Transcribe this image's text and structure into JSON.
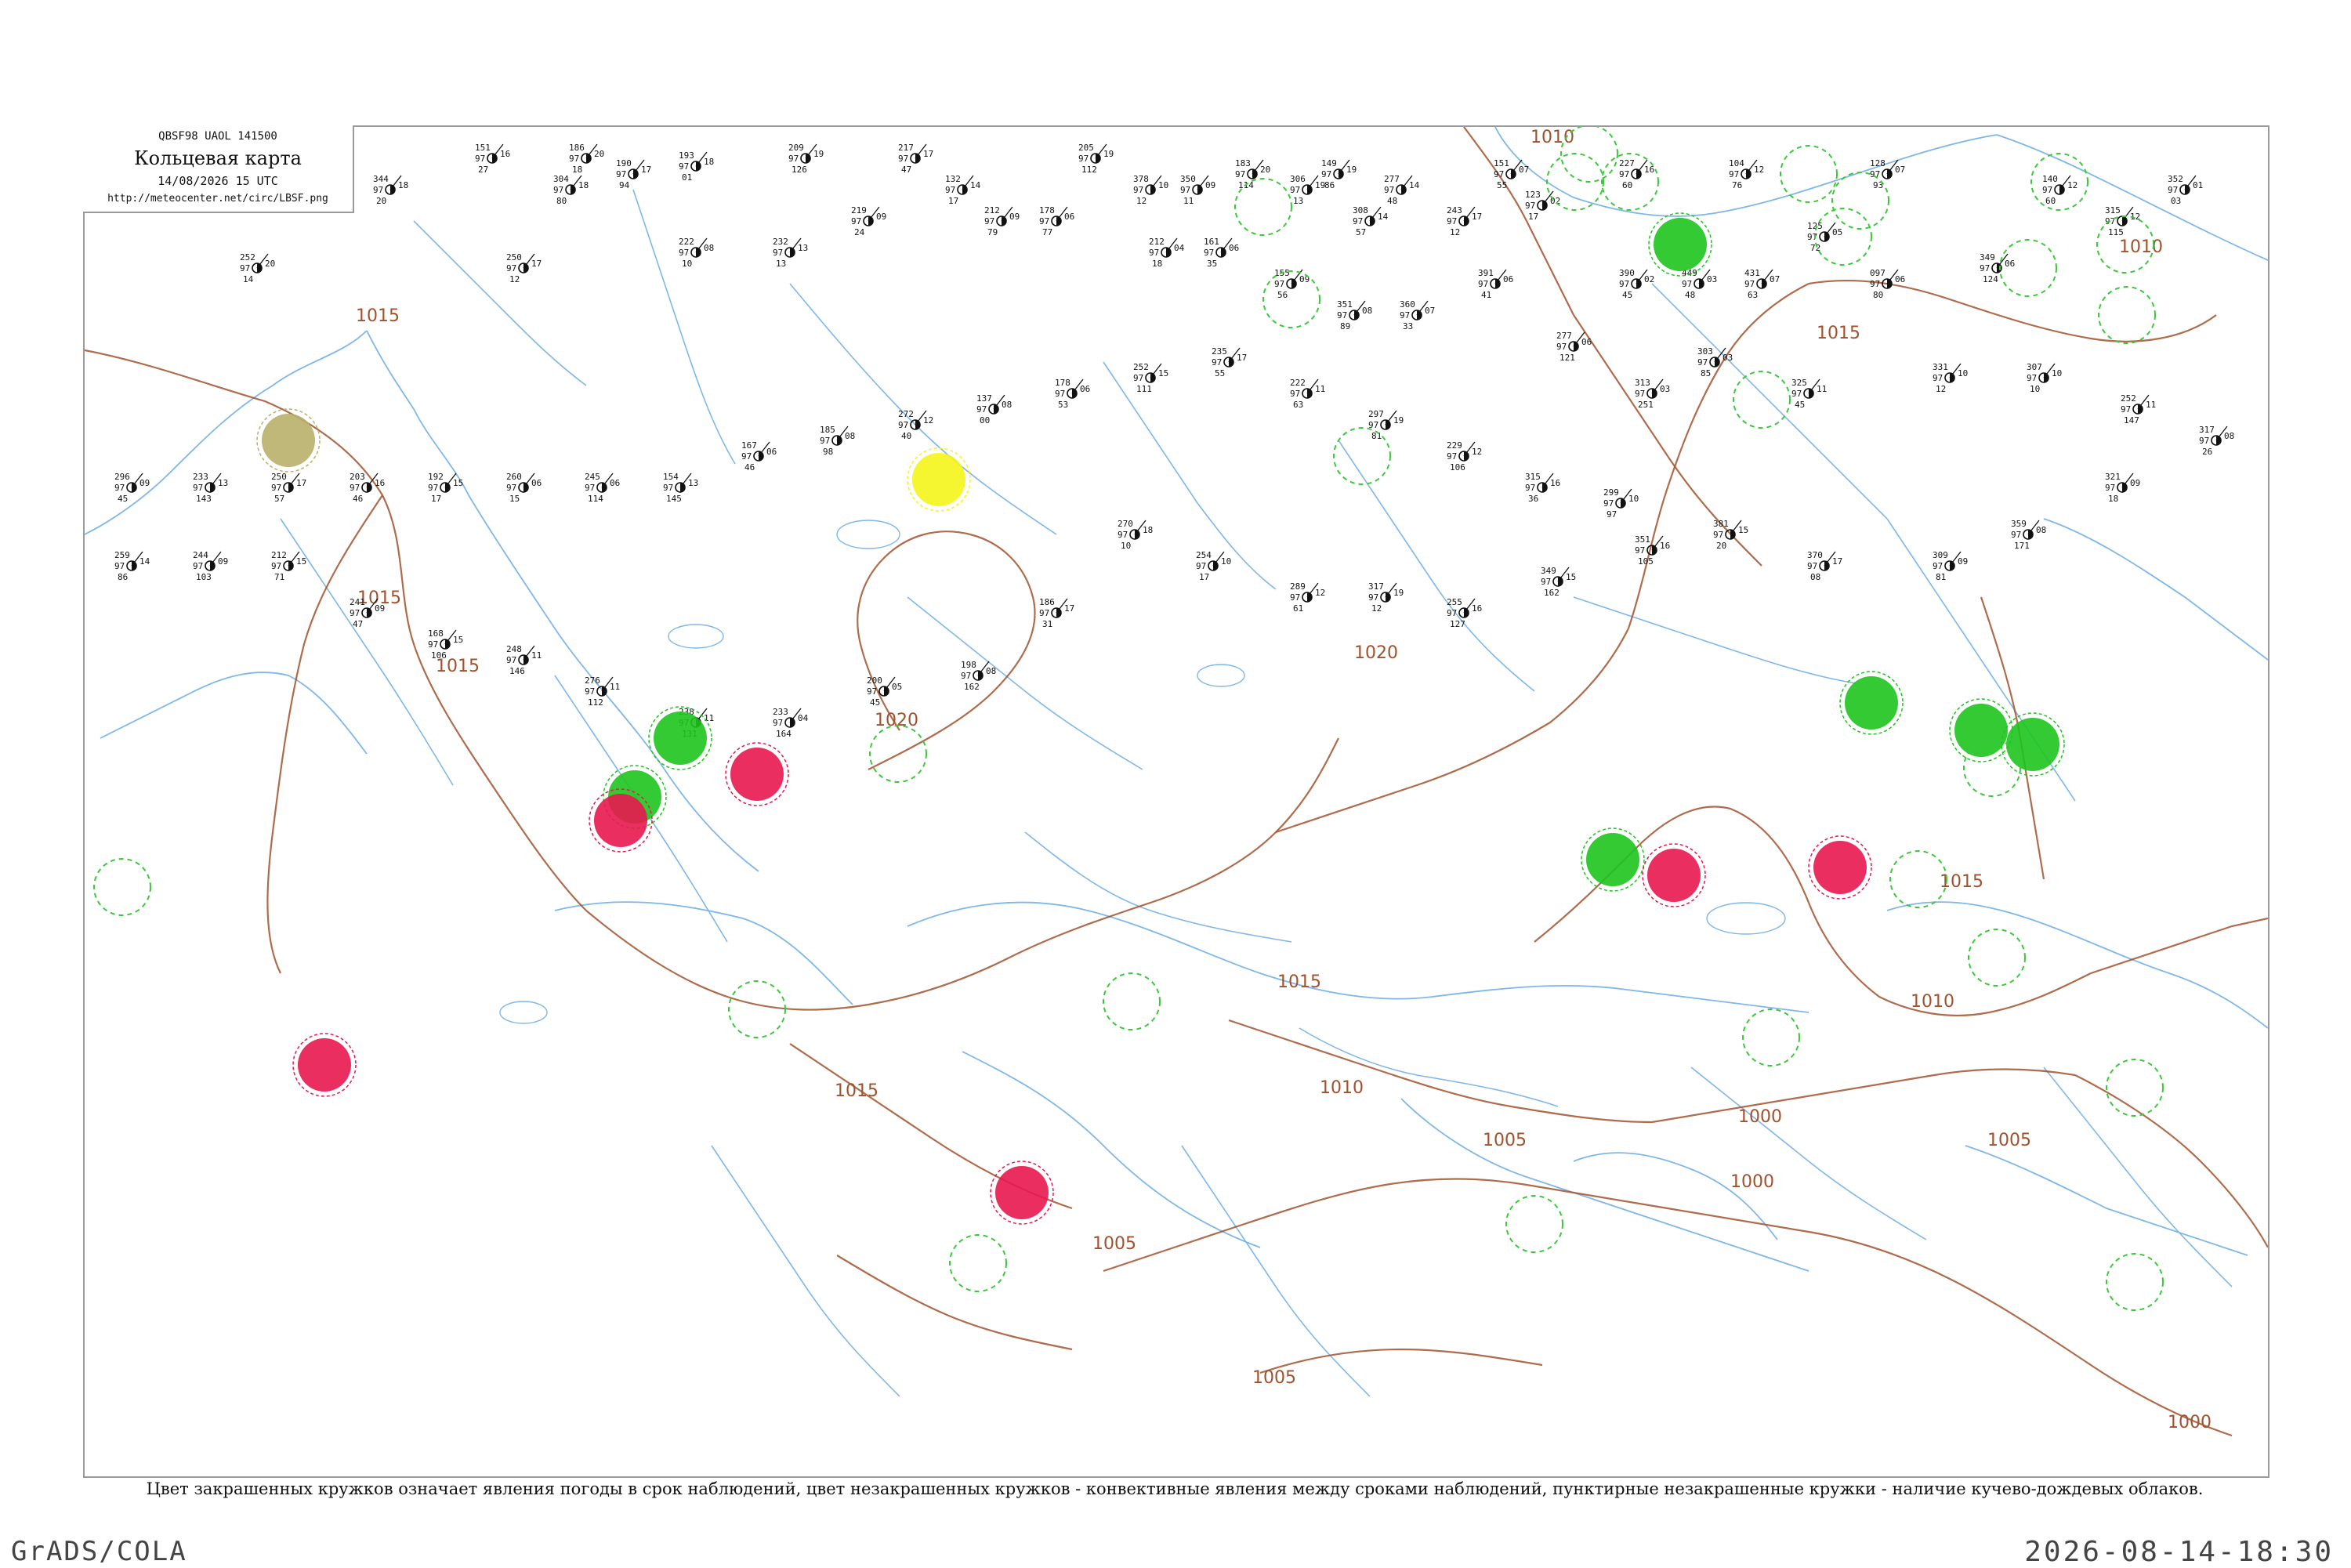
{
  "header": {
    "code_line": "QBSF98  UAOL  141500",
    "title": "Кольцевая карта",
    "datetime": "14/08/2026 15 UTC",
    "url": "http://meteocenter.net/circ/LBSF.png"
  },
  "caption": "Цвет закрашенных кружков означает явления погоды в срок наблюдений, цвет незакрашенных кружков - конвективные явления между сроками наблюдений, пунктирные незакрашенные кружки - наличие кучево-дождевых облаков.",
  "footer": {
    "left": "GrADS/COLA",
    "right": "2026-08-14-18:30"
  },
  "colors": {
    "isobar": "#a0522d",
    "river": "#7fb7e8",
    "rain_green": "#1ec41e",
    "thunder_red": "#e8174f",
    "fog_yellow": "#f5f51a",
    "haze_olive": "#b8b06a",
    "cb_dashed": "#3cc83c"
  },
  "isobar_labels": [
    "1015",
    "1015",
    "1015",
    "1020",
    "1020",
    "1015",
    "1015",
    "1015",
    "1010",
    "1015",
    "1010",
    "1005",
    "1005",
    "1005",
    "1000",
    "1000",
    "1005",
    "1010",
    "1010",
    "1000"
  ],
  "markers": [
    {
      "type": "haze",
      "color": "haze_olive"
    },
    {
      "type": "fog",
      "color": "fog_yellow"
    },
    {
      "type": "rain",
      "color": "rain_green"
    },
    {
      "type": "thunderstorm",
      "color": "thunder_red"
    },
    {
      "type": "cumulonimbus",
      "color": "cb_dashed"
    }
  ],
  "stations": [
    {
      "t": "151",
      "p": "16",
      "v": "97",
      "n": "27"
    },
    {
      "t": "186",
      "p": "20",
      "v": "97",
      "n": "18"
    },
    {
      "t": "190",
      "p": "17",
      "v": "97",
      "n": "94"
    },
    {
      "t": "193",
      "p": "18",
      "v": "97",
      "n": "01"
    },
    {
      "t": "209",
      "p": "19",
      "v": "97",
      "n": "126"
    },
    {
      "t": "217",
      "p": "17",
      "v": "97",
      "n": "47"
    },
    {
      "t": "205",
      "p": "19",
      "v": "97",
      "n": "112"
    },
    {
      "t": "183",
      "p": "20",
      "v": "97",
      "n": "114"
    },
    {
      "t": "149",
      "p": "19",
      "v": "97",
      "n": "86"
    },
    {
      "t": "151",
      "p": "07",
      "v": "97",
      "n": "55"
    },
    {
      "t": "227",
      "p": "16",
      "v": "97",
      "n": "60"
    },
    {
      "t": "104",
      "p": "12",
      "v": "97",
      "n": "76"
    },
    {
      "t": "128",
      "p": "07",
      "v": "97",
      "n": "93"
    },
    {
      "t": "344",
      "p": "18",
      "v": "97",
      "n": "20"
    },
    {
      "t": "304",
      "p": "18",
      "v": "97",
      "n": "80"
    },
    {
      "t": "132",
      "p": "14",
      "v": "97",
      "n": "17"
    },
    {
      "t": "378",
      "p": "10",
      "v": "97",
      "n": "12"
    },
    {
      "t": "350",
      "p": "09",
      "v": "97",
      "n": "11"
    },
    {
      "t": "306",
      "p": "19",
      "v": "97",
      "n": "13"
    },
    {
      "t": "308",
      "p": "14",
      "v": "97",
      "n": "57"
    },
    {
      "t": "277",
      "p": "14",
      "v": "97",
      "n": "48"
    },
    {
      "t": "243",
      "p": "17",
      "v": "97",
      "n": "12"
    },
    {
      "t": "252",
      "p": "20",
      "v": "97",
      "n": "14"
    },
    {
      "t": "250",
      "p": "17",
      "v": "97",
      "n": "12"
    },
    {
      "t": "222",
      "p": "08",
      "v": "97",
      "n": "10"
    },
    {
      "t": "232",
      "p": "13",
      "v": "97",
      "n": "13"
    },
    {
      "t": "219",
      "p": "09",
      "v": "97",
      "n": "24"
    },
    {
      "t": "212",
      "p": "09",
      "v": "97",
      "n": "79"
    },
    {
      "t": "178",
      "p": "06",
      "v": "97",
      "n": "77"
    },
    {
      "t": "212",
      "p": "04",
      "v": "97",
      "n": "18"
    },
    {
      "t": "161",
      "p": "06",
      "v": "97",
      "n": "35"
    },
    {
      "t": "155",
      "p": "09",
      "v": "97",
      "n": "56"
    },
    {
      "t": "123",
      "p": "02",
      "v": "97",
      "n": "17"
    },
    {
      "t": "125",
      "p": "05",
      "v": "97",
      "n": "72"
    },
    {
      "t": "097",
      "p": "06",
      "v": "97",
      "n": "80"
    },
    {
      "t": "349",
      "p": "06",
      "v": "97",
      "n": "124"
    },
    {
      "t": "140",
      "p": "12",
      "v": "97",
      "n": "60"
    },
    {
      "t": "315",
      "p": "12",
      "v": "97",
      "n": "115"
    },
    {
      "t": "352",
      "p": "01",
      "v": "97",
      "n": "03"
    },
    {
      "t": "390",
      "p": "02",
      "v": "97",
      "n": "45"
    },
    {
      "t": "449",
      "p": "03",
      "v": "97",
      "n": "48"
    },
    {
      "t": "431",
      "p": "07",
      "v": "97",
      "n": "63"
    },
    {
      "t": "351",
      "p": "08",
      "v": "97",
      "n": "89"
    },
    {
      "t": "360",
      "p": "07",
      "v": "97",
      "n": "33"
    },
    {
      "t": "391",
      "p": "06",
      "v": "97",
      "n": "41"
    },
    {
      "t": "277",
      "p": "06",
      "v": "97",
      "n": "121"
    },
    {
      "t": "313",
      "p": "03",
      "v": "97",
      "n": "251"
    },
    {
      "t": "303",
      "p": "03",
      "v": "97",
      "n": "85"
    },
    {
      "t": "325",
      "p": "11",
      "v": "97",
      "n": "45"
    },
    {
      "t": "331",
      "p": "10",
      "v": "97",
      "n": "12"
    },
    {
      "t": "307",
      "p": "10",
      "v": "97",
      "n": "10"
    },
    {
      "t": "252",
      "p": "11",
      "v": "97",
      "n": "147"
    },
    {
      "t": "317",
      "p": "08",
      "v": "97",
      "n": "26"
    },
    {
      "t": "321",
      "p": "09",
      "v": "97",
      "n": "18"
    },
    {
      "t": "359",
      "p": "08",
      "v": "97",
      "n": "171"
    },
    {
      "t": "309",
      "p": "09",
      "v": "97",
      "n": "81"
    },
    {
      "t": "370",
      "p": "17",
      "v": "97",
      "n": "08"
    },
    {
      "t": "381",
      "p": "15",
      "v": "97",
      "n": "20"
    },
    {
      "t": "351",
      "p": "16",
      "v": "97",
      "n": "105"
    },
    {
      "t": "349",
      "p": "15",
      "v": "97",
      "n": "162"
    },
    {
      "t": "255",
      "p": "16",
      "v": "97",
      "n": "127"
    },
    {
      "t": "317",
      "p": "19",
      "v": "97",
      "n": "12"
    },
    {
      "t": "289",
      "p": "12",
      "v": "97",
      "n": "61"
    },
    {
      "t": "254",
      "p": "10",
      "v": "97",
      "n": "17"
    },
    {
      "t": "270",
      "p": "18",
      "v": "97",
      "n": "10"
    },
    {
      "t": "186",
      "p": "17",
      "v": "97",
      "n": "31"
    },
    {
      "t": "198",
      "p": "08",
      "v": "97",
      "n": "162"
    },
    {
      "t": "200",
      "p": "05",
      "v": "97",
      "n": "45"
    },
    {
      "t": "233",
      "p": "04",
      "v": "97",
      "n": "164"
    },
    {
      "t": "238",
      "p": "11",
      "v": "97",
      "n": "131"
    },
    {
      "t": "276",
      "p": "11",
      "v": "97",
      "n": "112"
    },
    {
      "t": "248",
      "p": "11",
      "v": "97",
      "n": "146"
    },
    {
      "t": "168",
      "p": "15",
      "v": "97",
      "n": "106"
    },
    {
      "t": "241",
      "p": "09",
      "v": "97",
      "n": "47"
    },
    {
      "t": "212",
      "p": "15",
      "v": "97",
      "n": "71"
    },
    {
      "t": "244",
      "p": "09",
      "v": "97",
      "n": "103"
    },
    {
      "t": "259",
      "p": "14",
      "v": "97",
      "n": "86"
    },
    {
      "t": "296",
      "p": "09",
      "v": "97",
      "n": "45"
    },
    {
      "t": "233",
      "p": "13",
      "v": "97",
      "n": "143"
    },
    {
      "t": "250",
      "p": "17",
      "v": "97",
      "n": "57"
    },
    {
      "t": "203",
      "p": "16",
      "v": "97",
      "n": "46"
    },
    {
      "t": "192",
      "p": "15",
      "v": "97",
      "n": "17"
    },
    {
      "t": "260",
      "p": "06",
      "v": "97",
      "n": "15"
    },
    {
      "t": "245",
      "p": "06",
      "v": "97",
      "n": "114"
    },
    {
      "t": "154",
      "p": "13",
      "v": "97",
      "n": "145"
    },
    {
      "t": "167",
      "p": "06",
      "v": "97",
      "n": "46"
    },
    {
      "t": "185",
      "p": "08",
      "v": "97",
      "n": "98"
    },
    {
      "t": "272",
      "p": "12",
      "v": "97",
      "n": "40"
    },
    {
      "t": "137",
      "p": "08",
      "v": "97",
      "n": "00"
    },
    {
      "t": "178",
      "p": "06",
      "v": "97",
      "n": "53"
    },
    {
      "t": "252",
      "p": "15",
      "v": "97",
      "n": "111"
    },
    {
      "t": "235",
      "p": "17",
      "v": "97",
      "n": "55"
    },
    {
      "t": "222",
      "p": "11",
      "v": "97",
      "n": "63"
    },
    {
      "t": "297",
      "p": "19",
      "v": "97",
      "n": "81"
    },
    {
      "t": "229",
      "p": "12",
      "v": "97",
      "n": "106"
    },
    {
      "t": "315",
      "p": "16",
      "v": "97",
      "n": "36"
    },
    {
      "t": "299",
      "p": "10",
      "v": "97",
      "n": "97"
    }
  ]
}
